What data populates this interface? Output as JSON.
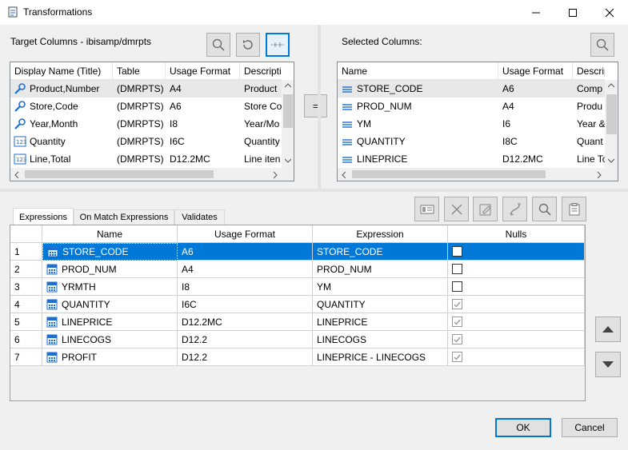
{
  "window": {
    "title": "Transformations",
    "minimize": "—",
    "maximize": "☐",
    "close": "✕"
  },
  "target": {
    "label": "Target Columns - ibisamp/dmrpts",
    "headers": [
      "Display Name (Title)",
      "Table",
      "Usage Format",
      "Description"
    ],
    "rows": [
      {
        "icon": "wrench-icon",
        "name": "Product,Number",
        "table": "(DMRPTS)",
        "format": "A4",
        "desc": "Product"
      },
      {
        "icon": "wrench-icon",
        "name": "Store,Code",
        "table": "(DMRPTS)",
        "format": "A6",
        "desc": "Store Co"
      },
      {
        "icon": "wrench-icon",
        "name": "Year,Month",
        "table": "(DMRPTS)",
        "format": "I8",
        "desc": "Year/Mo"
      },
      {
        "icon": "measure-icon",
        "name": "Quantity",
        "table": "(DMRPTS)",
        "format": "I6C",
        "desc": "Quantity"
      },
      {
        "icon": "measure-icon",
        "name": "Line,Total",
        "table": "(DMRPTS)",
        "format": "D12.2MC",
        "desc": "Line iten"
      }
    ]
  },
  "selected": {
    "label": "Selected Columns:",
    "headers": [
      "Name",
      "Usage Format",
      "Descriptio"
    ],
    "rows": [
      {
        "name": "STORE_CODE",
        "format": "A6",
        "desc": "Comp"
      },
      {
        "name": "PROD_NUM",
        "format": "A4",
        "desc": "Produ"
      },
      {
        "name": "YM",
        "format": "I6",
        "desc": "Year &"
      },
      {
        "name": "QUANTITY",
        "format": "I8C",
        "desc": "Quant"
      },
      {
        "name": "LINEPRICE",
        "format": "D12.2MC",
        "desc": "Line Tc"
      }
    ]
  },
  "equals_label": "=",
  "tabs": [
    "Expressions",
    "On Match Expressions",
    "Validates"
  ],
  "expr": {
    "headers": [
      "Name",
      "Usage Format",
      "Expression",
      "Nulls"
    ],
    "rows": [
      {
        "num": "1",
        "name": "STORE_CODE",
        "format": "A6",
        "expr": "STORE_CODE",
        "nulls": false,
        "enabled": true
      },
      {
        "num": "2",
        "name": "PROD_NUM",
        "format": "A4",
        "expr": "PROD_NUM",
        "nulls": false,
        "enabled": true
      },
      {
        "num": "3",
        "name": "YRMTH",
        "format": "I8",
        "expr": "YM",
        "nulls": false,
        "enabled": true
      },
      {
        "num": "4",
        "name": "QUANTITY",
        "format": "I6C",
        "expr": "QUANTITY",
        "nulls": true,
        "enabled": false
      },
      {
        "num": "5",
        "name": "LINEPRICE",
        "format": "D12.2MC",
        "expr": "LINEPRICE",
        "nulls": true,
        "enabled": false
      },
      {
        "num": "6",
        "name": "LINECOGS",
        "format": "D12.2",
        "expr": "LINECOGS",
        "nulls": true,
        "enabled": false
      },
      {
        "num": "7",
        "name": "PROFIT",
        "format": "D12.2",
        "expr": "LINEPRICE - LINECOGS",
        "nulls": true,
        "enabled": false
      }
    ]
  },
  "buttons": {
    "ok": "OK",
    "cancel": "Cancel"
  },
  "colors": {
    "selection": "#0078d7",
    "accent": "#0078d7",
    "icon_blue": "#1e6fd0"
  }
}
